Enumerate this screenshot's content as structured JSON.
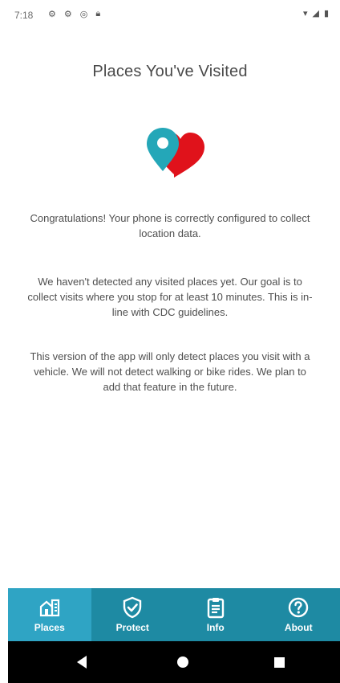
{
  "status_bar": {
    "time": "7:18",
    "left_icons": [
      "settings-icon",
      "settings-icon",
      "vpn-icon",
      "lock-icon"
    ],
    "right_icons": [
      "wifi-icon",
      "signal-icon",
      "battery-icon"
    ]
  },
  "page": {
    "title": "Places You've Visited",
    "hero_icon": "location-heart-icon",
    "paragraphs": [
      "Congratulations! Your phone is correctly configured to collect location data.",
      "We haven't detected any visited places yet. Our goal is to collect visits where you stop for at least 10 minutes. This is in-line with CDC guidelines.",
      "This version of the app will only detect places you visit with a vehicle. We will not detect walking or bike rides. We plan to add that feature in the future."
    ]
  },
  "bottom_nav": {
    "items": [
      {
        "label": "Places",
        "icon": "places-icon",
        "active": true
      },
      {
        "label": "Protect",
        "icon": "shield-check-icon",
        "active": false
      },
      {
        "label": "Info",
        "icon": "clipboard-icon",
        "active": false
      },
      {
        "label": "About",
        "icon": "help-icon",
        "active": false
      }
    ]
  },
  "colors": {
    "accent": "#1e8aa3",
    "accent_active": "#2fa4c4",
    "heart_red": "#e0121b",
    "pin_teal": "#24a7b8"
  }
}
